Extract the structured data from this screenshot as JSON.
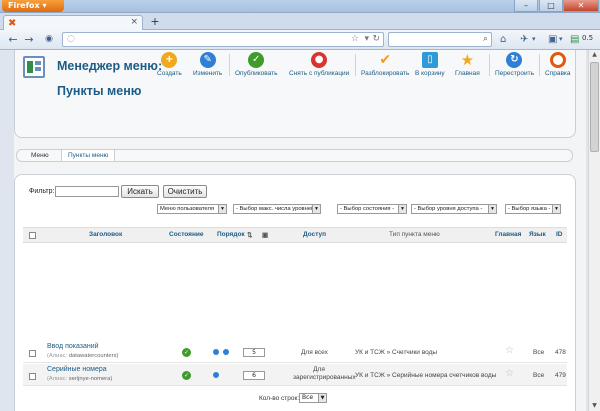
{
  "browser": {
    "app_button": "Firefox",
    "tab_close": "×",
    "new_tab": "+",
    "zoom_badge": "0.5"
  },
  "page": {
    "title": "Менеджер меню: Пункты меню"
  },
  "toolbar": {
    "items": [
      {
        "label": "Создать",
        "icon": "plus-icon",
        "color": "#f0a81e",
        "glyph": "+"
      },
      {
        "label": "Изменить",
        "icon": "edit-icon",
        "color": "#2f7fd5",
        "glyph": "✎"
      },
      {
        "label": "Опубликовать",
        "icon": "publish-icon",
        "color": "#3f9b2b",
        "glyph": "✓"
      },
      {
        "label": "Снять с публикации",
        "icon": "unpublish-icon",
        "color": "#d9332b",
        "glyph": "●"
      },
      {
        "label": "Разблокировать",
        "icon": "checkin-icon",
        "color": "#f39a1e",
        "glyph": "✔"
      },
      {
        "label": "В корзину",
        "icon": "trash-icon",
        "color": "#2f9ad5",
        "glyph": "🗑"
      },
      {
        "label": "Главная",
        "icon": "star-icon",
        "color": "#f0a81e",
        "glyph": "★"
      },
      {
        "label": "Перестроить",
        "icon": "rebuild-icon",
        "color": "#2f7fd5",
        "glyph": "↻"
      },
      {
        "label": "Справка",
        "icon": "help-icon",
        "color": "#e2580d",
        "glyph": "?"
      }
    ]
  },
  "submenu": {
    "items": [
      "Меню",
      "Пункты меню"
    ],
    "active": "Пункты меню"
  },
  "filter": {
    "label": "Фильтр:",
    "value": "",
    "search_button": "Искать",
    "clear_button": "Очистить",
    "selects": [
      "Меню пользователя",
      "- Выбор макс. числа уровней -",
      "- Выбор состояния -",
      "- Выбор уровня доступа -",
      "- Выбор языка -"
    ]
  },
  "table": {
    "headers": {
      "title": "Заголовок",
      "state": "Состояние",
      "order": "Порядок",
      "access": "Доступ",
      "type": "Тип пункта меню",
      "home": "Главная",
      "language": "Язык",
      "id": "ID"
    },
    "rows": [
      {
        "title": "Ввод показаний",
        "alias_label": "(Алиас:",
        "alias": "datawatercounters)",
        "order": "5",
        "access": "Для всех",
        "type": "УК и ТСЖ » Счетчики воды",
        "language": "Все",
        "id": "478"
      },
      {
        "title": "Серийные номера",
        "alias_label": "(Алиас:",
        "alias": "serijnye-nomera)",
        "order": "6",
        "access": "Для зарегистрированных",
        "type": "УК и ТСЖ » Серийные номера счетчиков воды",
        "language": "Все",
        "id": "479"
      }
    ]
  },
  "pagination": {
    "label": "Кол-во строк:",
    "value": "Все"
  }
}
